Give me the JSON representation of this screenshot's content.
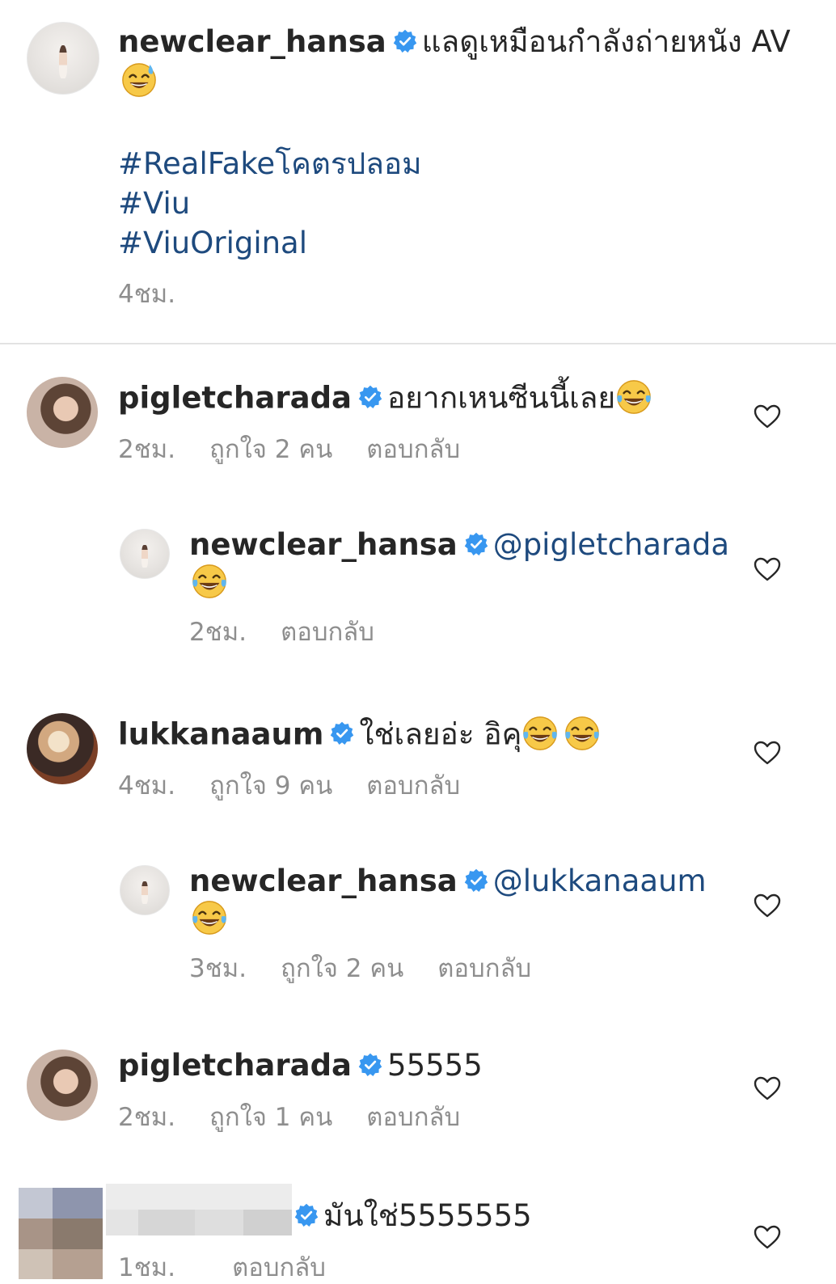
{
  "caption": {
    "username": "newclear_hansa",
    "text": "แลดูเหมือนกำลังถ่ายหนัง AV",
    "emoji": "sweat-smile-emoji",
    "hashtags": [
      "#RealFakeโคตรปลอม",
      "#Viu",
      "#ViuOriginal"
    ],
    "time": "4ชม."
  },
  "comments": [
    {
      "username": "pigletcharada",
      "text": "อยากเหนซีนนี้เลย",
      "emoji": "tears-of-joy-emoji",
      "time": "2ชม.",
      "likes": "ถูกใจ 2 คน",
      "reply_label": "ตอบกลับ",
      "reply": {
        "username": "newclear_hansa",
        "mention": "@pigletcharada",
        "emoji": "tears-of-joy-emoji",
        "time": "2ชม.",
        "reply_label": "ตอบกลับ"
      }
    },
    {
      "username": "lukkanaaum",
      "text": "ใช่เลยอ่ะ อิคุ",
      "emoji": "tears-of-joy-emoji",
      "time": "4ชม.",
      "likes": "ถูกใจ 9 คน",
      "reply_label": "ตอบกลับ",
      "reply": {
        "username": "newclear_hansa",
        "mention": "@lukkanaaum",
        "emoji": "tears-of-joy-emoji",
        "time": "3ชม.",
        "likes": "ถูกใจ 2 คน",
        "reply_label": "ตอบกลับ"
      }
    },
    {
      "username": "pigletcharada",
      "text": "55555",
      "time": "2ชม.",
      "likes": "ถูกใจ 1 คน",
      "reply_label": "ตอบกลับ"
    },
    {
      "text": "มันใช่5555555",
      "time": "1ชม.",
      "reply_label": "ตอบกลับ"
    }
  ],
  "colors": {
    "verified": "#3897f0",
    "hashtag": "#1e4a7e",
    "meta": "#8e8e8e",
    "text": "#262626"
  }
}
